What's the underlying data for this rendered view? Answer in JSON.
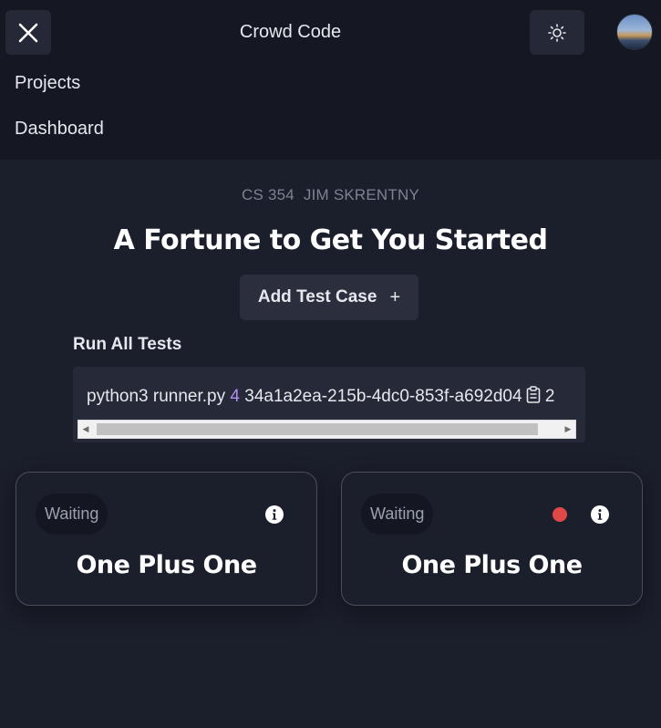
{
  "header": {
    "app_title": "Crowd Code",
    "close_icon": "close-icon",
    "theme_icon": "sun-icon",
    "avatar_alt": "user avatar"
  },
  "nav": {
    "items": [
      {
        "label": "Projects"
      },
      {
        "label": "Dashboard"
      }
    ]
  },
  "breadcrumb": {
    "course": "CS 354",
    "instructor": "JIM SKRENTNY"
  },
  "page": {
    "title": "A Fortune to Get You Started",
    "add_button_label": "Add Test Case",
    "add_button_icon": "+"
  },
  "run_all": {
    "label": "Run All Tests",
    "command_prefix": "python3 runner.py",
    "command_arg": "4",
    "command_id": "34a1a2ea-215b-4dc0-853f-a692d04",
    "command_overflow": "2",
    "clipboard_icon": "clipboard-icon"
  },
  "colors": {
    "background": "#1b1e2b",
    "topbar": "#151823",
    "arg_highlight": "#b48ef0",
    "error_dot": "#e04848"
  },
  "test_cases": [
    {
      "status": "Waiting",
      "title": "One Plus One",
      "has_error_dot": false
    },
    {
      "status": "Waiting",
      "title": "One Plus One",
      "has_error_dot": true
    }
  ]
}
